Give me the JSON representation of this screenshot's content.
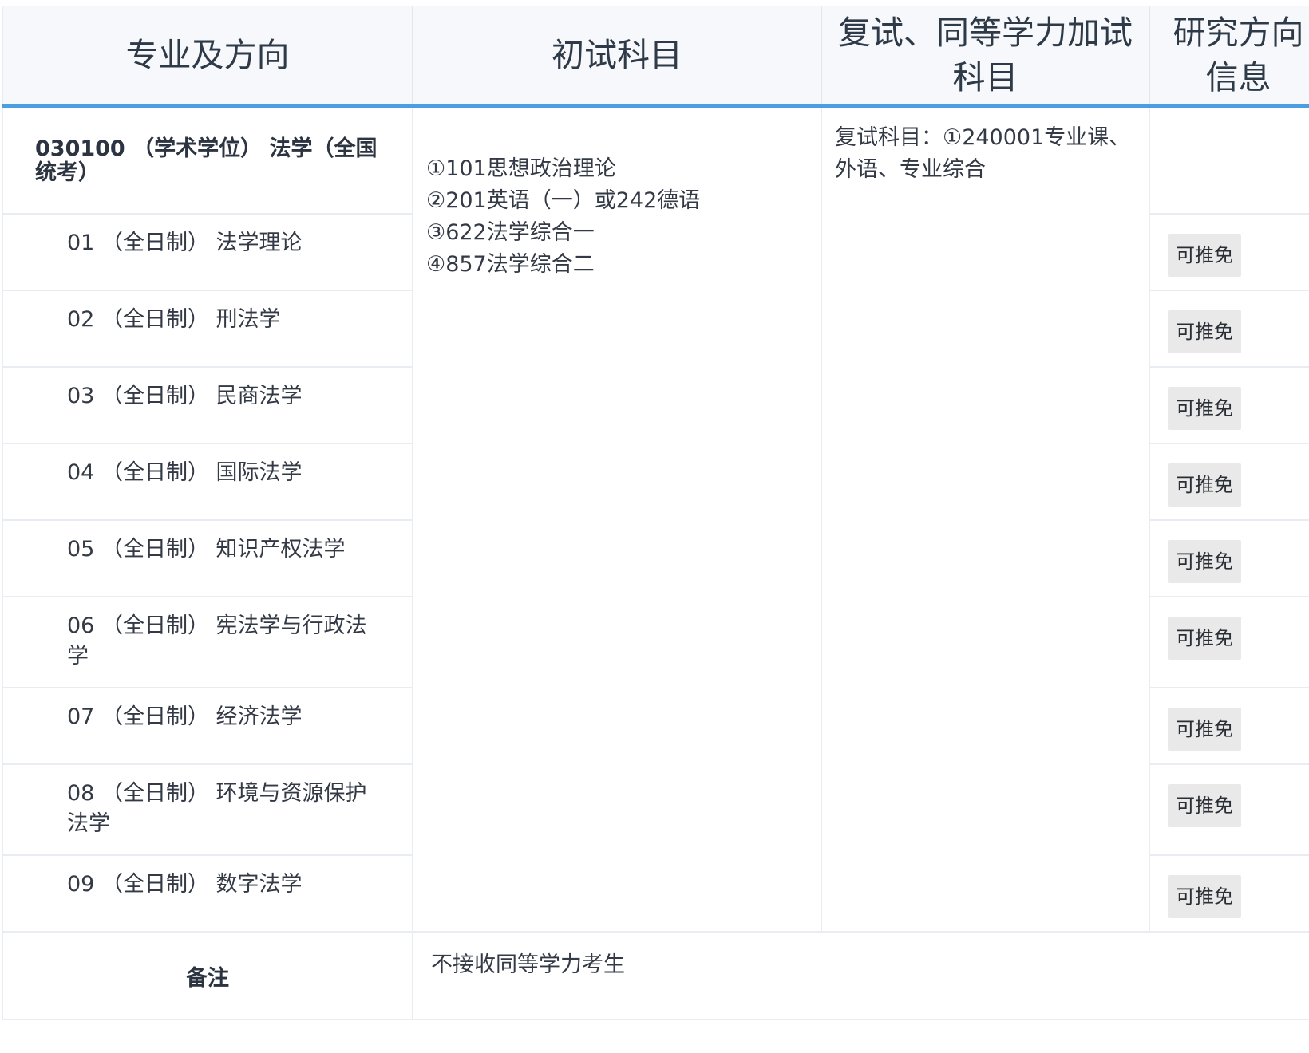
{
  "table": {
    "headers": {
      "major_direction": "专业及方向",
      "initial_subjects": "初试科目",
      "retest_subjects": "复试、同等学力加试科目",
      "research_info": "研究方向信息"
    },
    "major": {
      "title": "030100 （学术学位） 法学（全国统考）",
      "initial_subjects": [
        "①101思想政治理论",
        "②201英语（一）或242德语",
        "③622法学综合一",
        "④857法学综合二"
      ],
      "retest": "复试科目：①240001专业课、外语、专业综合"
    },
    "directions": [
      {
        "label": "01 （全日制） 法学理论",
        "badge": "可推免"
      },
      {
        "label": "02 （全日制） 刑法学",
        "badge": "可推免"
      },
      {
        "label": "03 （全日制） 民商法学",
        "badge": "可推免"
      },
      {
        "label": "04 （全日制） 国际法学",
        "badge": "可推免"
      },
      {
        "label": "05 （全日制） 知识产权法学",
        "badge": "可推免"
      },
      {
        "label": "06 （全日制） 宪法学与行政法学",
        "badge": "可推免"
      },
      {
        "label": "07 （全日制） 经济法学",
        "badge": "可推免"
      },
      {
        "label": "08 （全日制） 环境与资源保护法学",
        "badge": "可推免"
      },
      {
        "label": "09 （全日制） 数字法学",
        "badge": "可推免"
      }
    ],
    "remarks": {
      "label": "备注",
      "value": "不接收同等学力考生"
    }
  },
  "colors": {
    "header_background": "#f6f8fb",
    "header_underline": "#4a9ee2",
    "grid_line": "#e9edf1",
    "badge_background": "#e9e9e9",
    "text": "#333a45"
  }
}
